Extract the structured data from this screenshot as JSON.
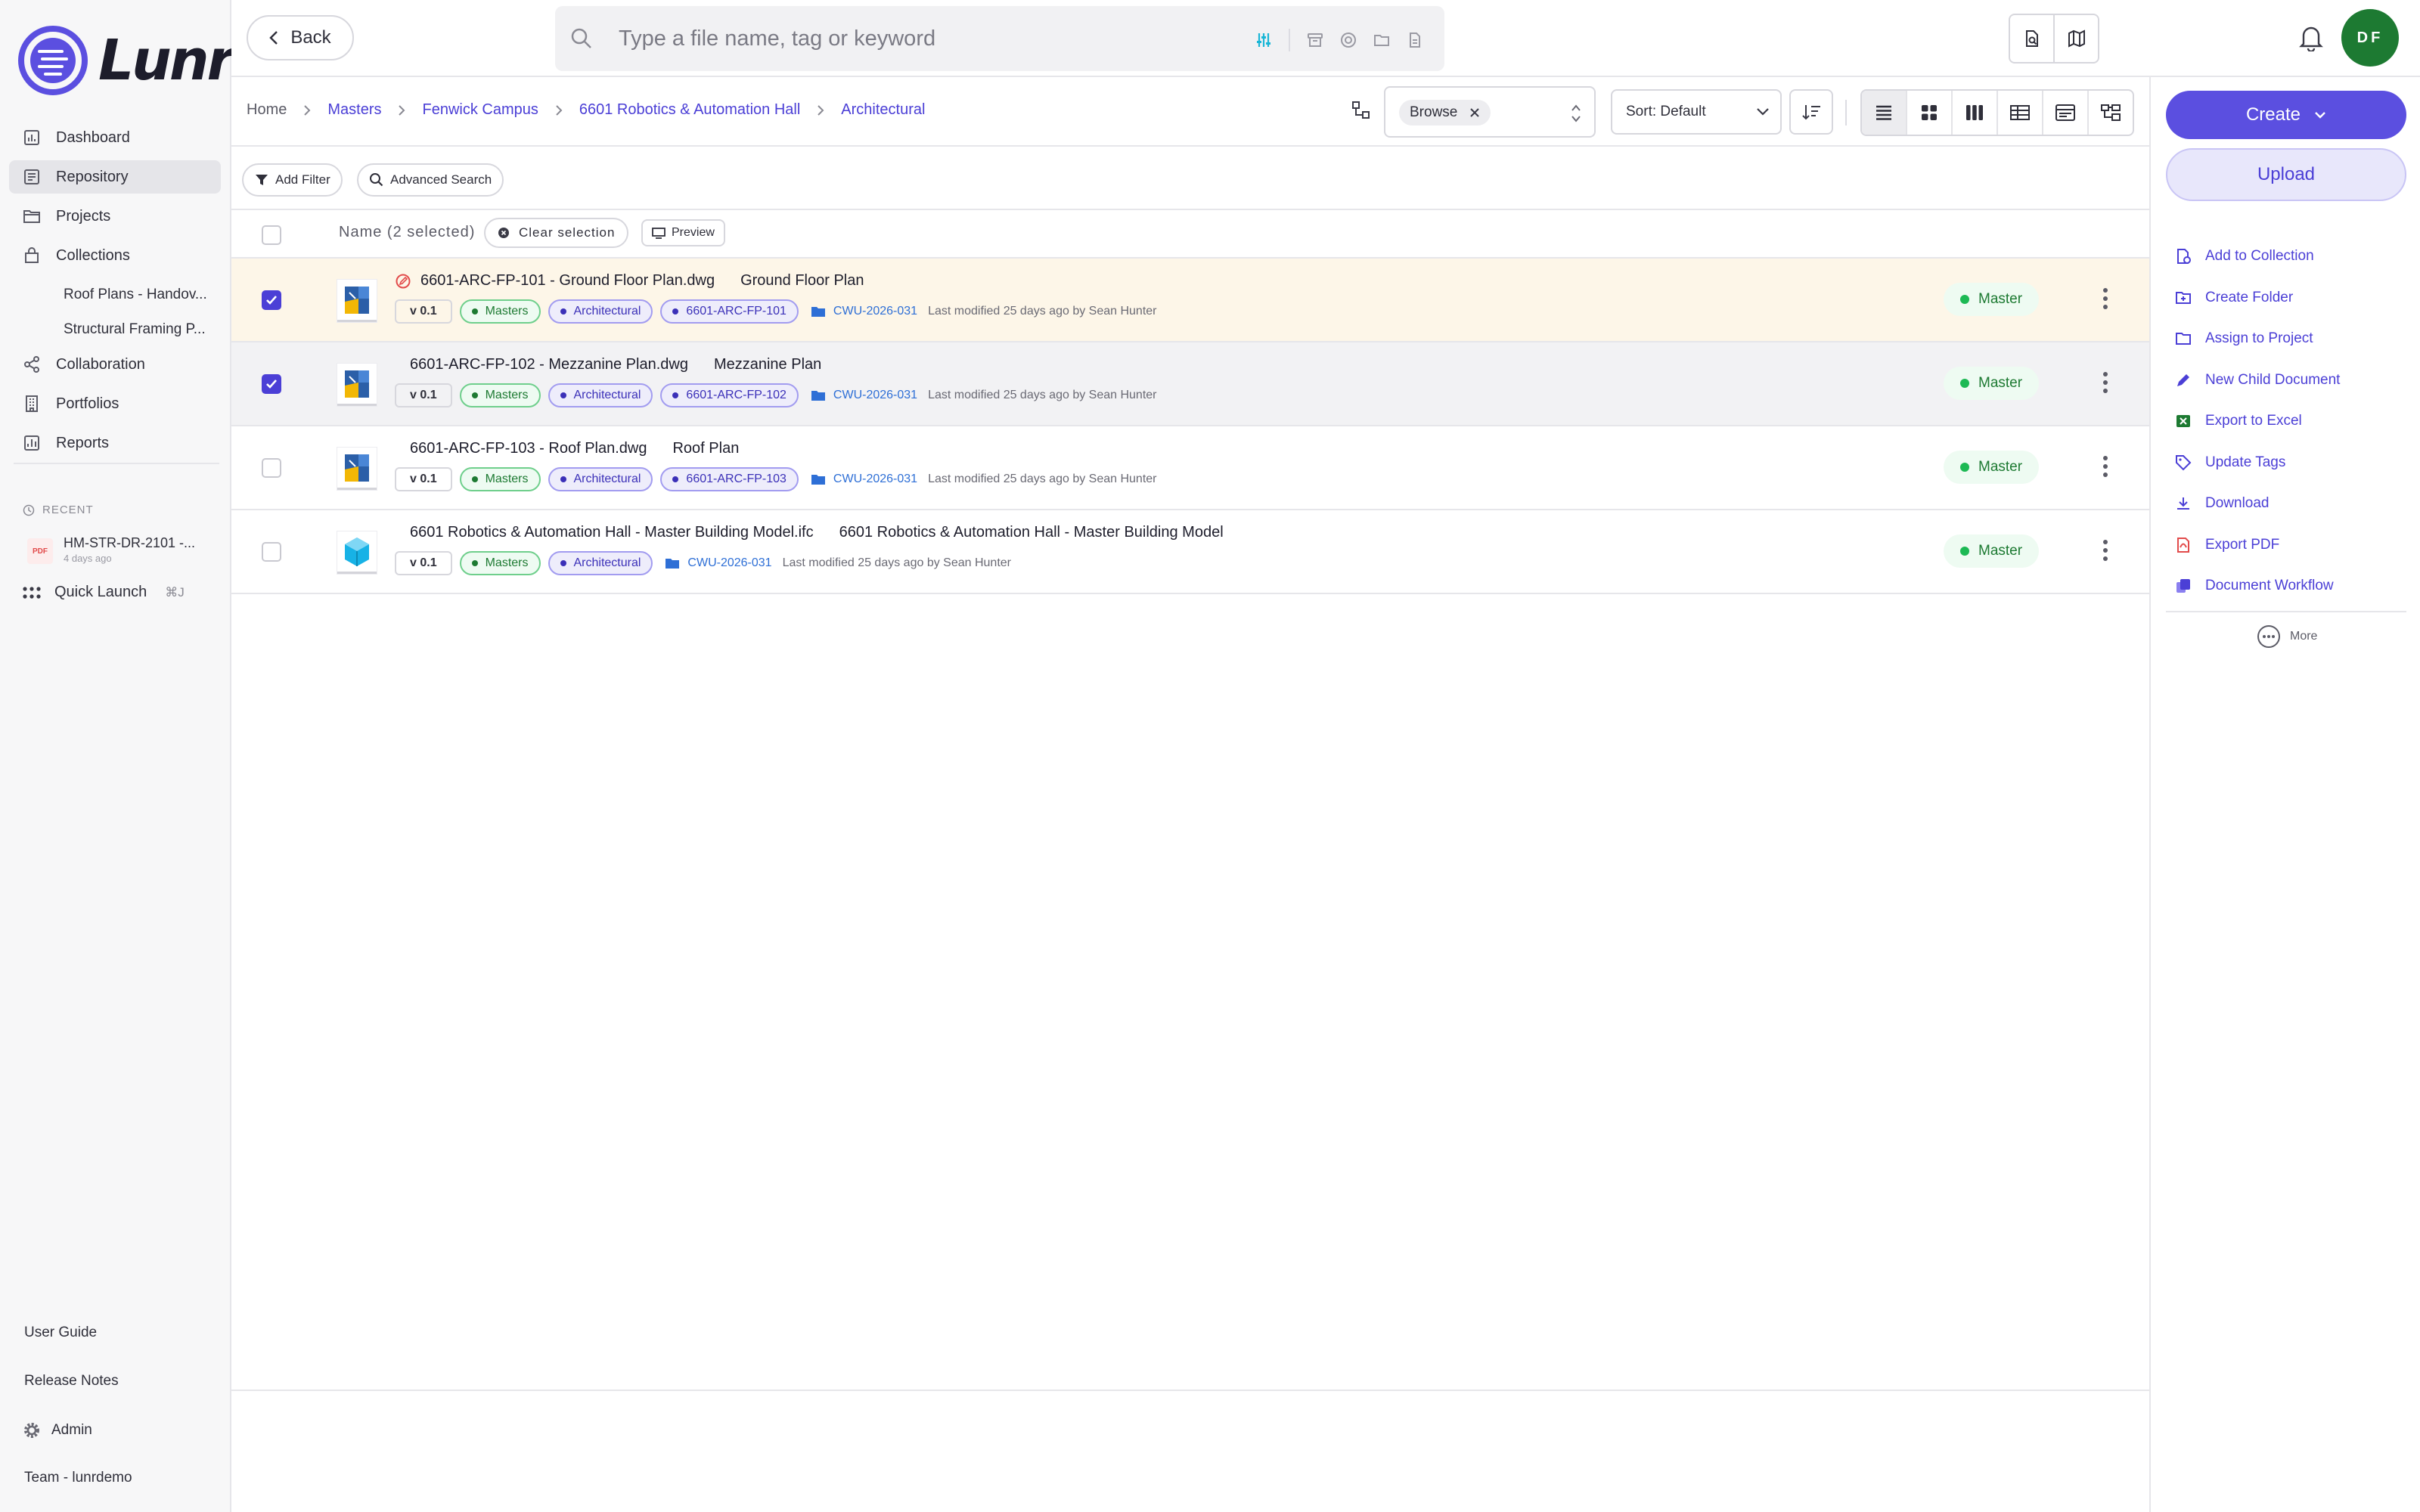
{
  "app": {
    "logo_text": "Lunr"
  },
  "sidebar": {
    "items": [
      {
        "label": "Dashboard",
        "icon": "chart-icon"
      },
      {
        "label": "Repository",
        "icon": "repository-icon"
      },
      {
        "label": "Projects",
        "icon": "folder-icon"
      },
      {
        "label": "Collections",
        "icon": "collections-icon"
      },
      {
        "label": "Collaboration",
        "icon": "share-icon"
      },
      {
        "label": "Portfolios",
        "icon": "building-icon"
      },
      {
        "label": "Reports",
        "icon": "report-icon"
      }
    ],
    "collections": [
      "Roof Plans - Handov...",
      "Structural Framing P..."
    ],
    "recent_label": "RECENT",
    "recent_item": {
      "badge": "PDF",
      "title": "HM-STR-DR-2101 -...",
      "subtitle": "4 days ago"
    },
    "quick_launch": {
      "label": "Quick Launch",
      "shortcut": "⌘J"
    },
    "bottom": {
      "user_guide": "User Guide",
      "release_notes": "Release Notes",
      "admin": "Admin",
      "team": "Team - lunrdemo"
    }
  },
  "topbar": {
    "back_label": "Back",
    "search_placeholder": "Type a file name, tag or keyword",
    "avatar_initials": "DF"
  },
  "breadcrumb": [
    "Home",
    "Masters",
    "Fenwick Campus",
    "6601 Robotics & Automation Hall",
    "Architectural"
  ],
  "toolbar": {
    "browse_chip": "Browse",
    "sort_label": "Sort: Default"
  },
  "filters": {
    "add_filter": "Add Filter",
    "advanced_search": "Advanced Search"
  },
  "table": {
    "name_header": "Name (2 selected)",
    "clear_selection": "Clear selection",
    "preview": "Preview",
    "rows": [
      {
        "filename": "6601-ARC-FP-101 - Ground Floor Plan.dwg",
        "title": "Ground Floor Plan",
        "version": "v 0.1",
        "tags": [
          "Masters",
          "Architectural",
          "6601-ARC-FP-101"
        ],
        "folder": "CWU-2026-031",
        "modified": "Last modified 25 days ago by Sean Hunter",
        "status": "Master",
        "checked": true,
        "edited": true,
        "type": "dwg"
      },
      {
        "filename": "6601-ARC-FP-102 - Mezzanine Plan.dwg",
        "title": "Mezzanine Plan",
        "version": "v 0.1",
        "tags": [
          "Masters",
          "Architectural",
          "6601-ARC-FP-102"
        ],
        "folder": "CWU-2026-031",
        "modified": "Last modified 25 days ago by Sean Hunter",
        "status": "Master",
        "checked": true,
        "edited": false,
        "type": "dwg"
      },
      {
        "filename": "6601-ARC-FP-103 - Roof Plan.dwg",
        "title": "Roof Plan",
        "version": "v 0.1",
        "tags": [
          "Masters",
          "Architectural",
          "6601-ARC-FP-103"
        ],
        "folder": "CWU-2026-031",
        "modified": "Last modified 25 days ago by Sean Hunter",
        "status": "Master",
        "checked": false,
        "edited": false,
        "type": "dwg"
      },
      {
        "filename": "6601 Robotics & Automation Hall - Master Building Model.ifc",
        "title": "6601 Robotics & Automation Hall - Master Building Model",
        "version": "v 0.1",
        "tags": [
          "Masters",
          "Architectural"
        ],
        "folder": "CWU-2026-031",
        "modified": "Last modified 25 days ago by Sean Hunter",
        "status": "Master",
        "checked": false,
        "edited": false,
        "type": "ifc"
      }
    ]
  },
  "right_panel": {
    "create_label": "Create",
    "upload_label": "Upload",
    "actions": [
      {
        "label": "Add to Collection",
        "icon": "add-collection-icon"
      },
      {
        "label": "Create Folder",
        "icon": "create-folder-icon"
      },
      {
        "label": "Assign to Project",
        "icon": "assign-project-icon"
      },
      {
        "label": "New Child Document",
        "icon": "pencil-icon"
      },
      {
        "label": "Export to Excel",
        "icon": "excel-icon"
      },
      {
        "label": "Update Tags",
        "icon": "tag-icon"
      },
      {
        "label": "Download",
        "icon": "download-icon"
      },
      {
        "label": "Export PDF",
        "icon": "pdf-icon"
      },
      {
        "label": "Document Workflow",
        "icon": "workflow-icon"
      }
    ],
    "more_label": "More"
  },
  "colors": {
    "accent": "#4b3fd6",
    "primary_button": "#5b4fe0",
    "avatar": "#1d7a32",
    "status_green": "#1db954",
    "selected_row": "#fdf6e8"
  }
}
